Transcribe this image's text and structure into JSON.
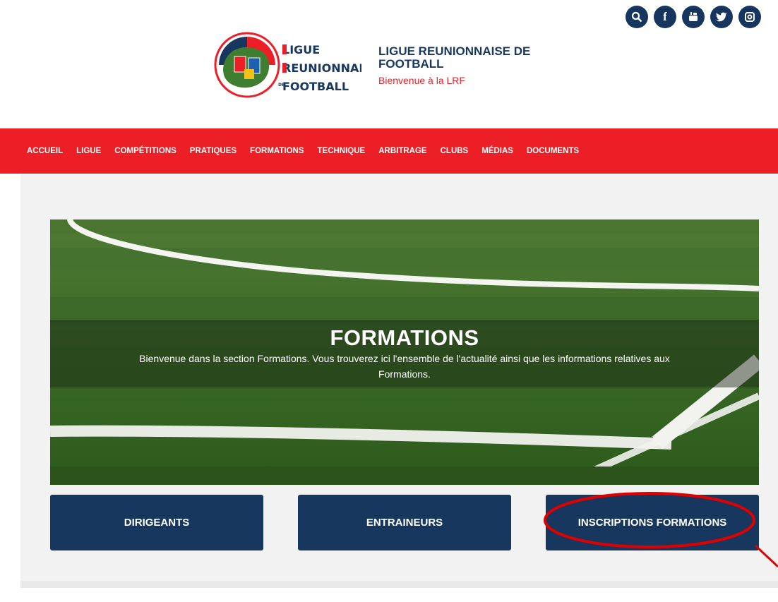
{
  "social": [
    {
      "name": "search-icon",
      "glyph": "⌕"
    },
    {
      "name": "facebook-icon",
      "glyph": "f"
    },
    {
      "name": "youtube-icon",
      "glyph": "▶"
    },
    {
      "name": "twitter-icon",
      "glyph": "✦"
    },
    {
      "name": "instagram-icon",
      "glyph": "◎"
    }
  ],
  "header": {
    "logo_lines": [
      "LIGUE",
      "REUNIONNAISE",
      "FOOTBALL"
    ],
    "logo_de": "DE",
    "title_line1": "LIGUE REUNIONNAISE DE",
    "title_line2": "FOOTBALL",
    "subtitle": "Bienvenue à la LRF"
  },
  "nav": [
    "ACCUEIL",
    "LIGUE",
    "COMPÉTITIONS",
    "PRATIQUES",
    "FORMATIONS",
    "TECHNIQUE",
    "ARBITRAGE",
    "CLUBS",
    "MÉDIAS",
    "DOCUMENTS"
  ],
  "hero": {
    "title": "FORMATIONS",
    "description": "Bienvenue dans la section Formations. Vous trouverez ici l'ensemble de l'actualité ainsi que les informations relatives aux Formations."
  },
  "buttons": [
    "DIRIGEANTS",
    "ENTRAINEURS",
    "INSCRIPTIONS FORMATIONS"
  ],
  "colors": {
    "navy": "#17375e",
    "red": "#ec1f27",
    "highlight": "#e00000"
  }
}
